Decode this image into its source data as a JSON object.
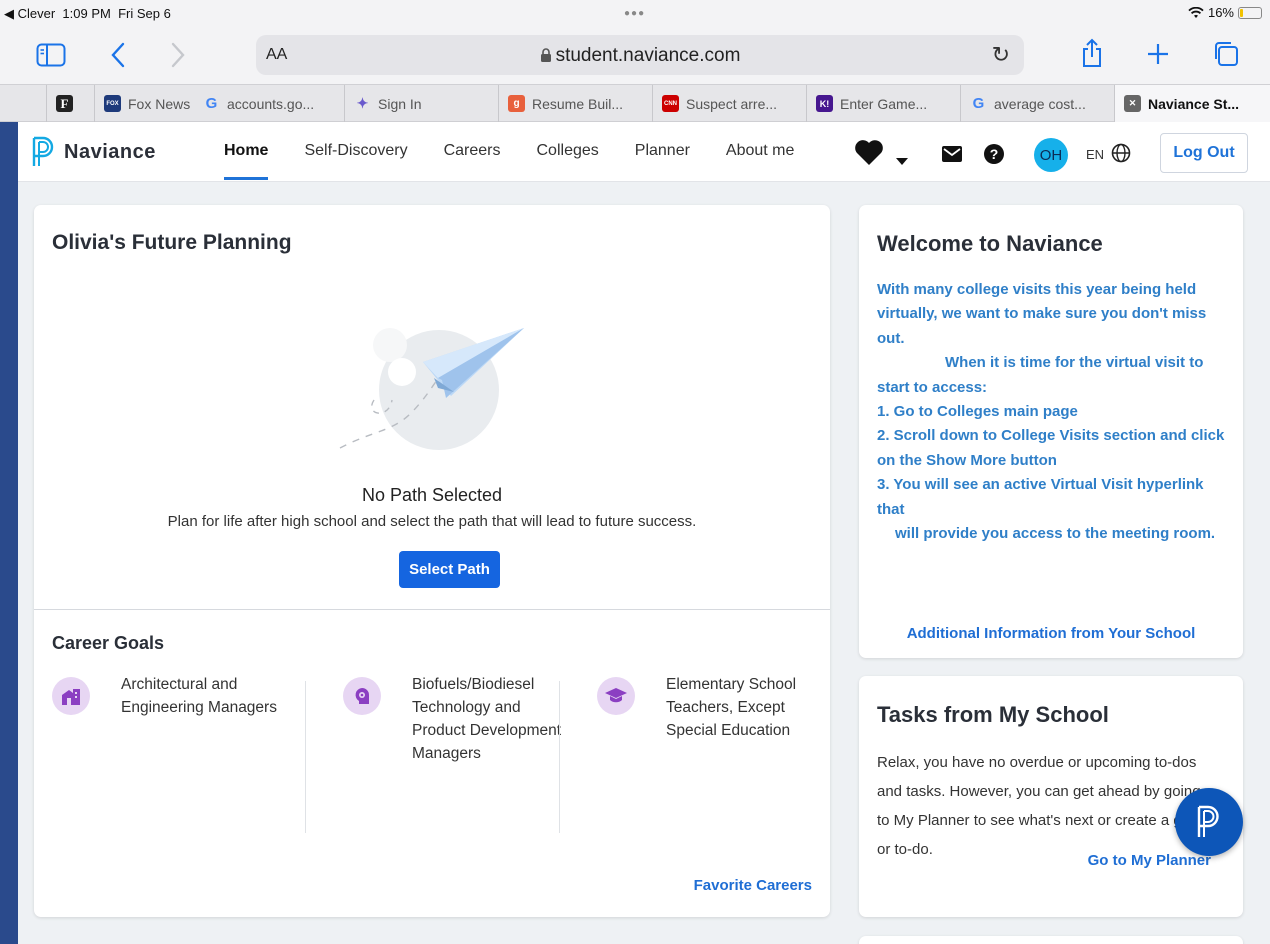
{
  "status_bar": {
    "back_app": "◀ Clever",
    "time": "1:09 PM",
    "date": "Fri Sep 6",
    "battery": "16%",
    "battery_level": 0.16
  },
  "browser": {
    "text_size_label": "AA",
    "url": "student.naviance.com"
  },
  "tabs": [
    {
      "label": "Fox News",
      "favicon_text": "FOX",
      "favicon_color": "#1e3a7b"
    },
    {
      "label": "accounts.go...",
      "favicon_text": "G",
      "favicon_color": "#4285f4"
    },
    {
      "label": "Sign In",
      "favicon_text": "✦",
      "favicon_color": "#6a5acd"
    },
    {
      "label": "Resume Buil...",
      "favicon_text": "g",
      "favicon_color": "#e8603c"
    },
    {
      "label": "Suspect arre...",
      "favicon_text": "CNN",
      "favicon_color": "#cc0000"
    },
    {
      "label": "Enter Game...",
      "favicon_text": "K!",
      "favicon_color": "#46178f"
    },
    {
      "label": "average cost...",
      "favicon_text": "G",
      "favicon_color": "#4285f4"
    },
    {
      "label": "Naviance St...",
      "favicon_text": "✕",
      "favicon_color": "#666666"
    }
  ],
  "nav": {
    "brand": "Naviance",
    "links": [
      "Home",
      "Self-Discovery",
      "Careers",
      "Colleges",
      "Planner",
      "About me"
    ],
    "avatar": "OH",
    "language": "EN",
    "logout": "Log Out"
  },
  "future_planning": {
    "title": "Olivia's Future Planning",
    "empty_title": "No Path Selected",
    "empty_desc": "Plan for life after high school and select the path that will lead to future success.",
    "select_button": "Select Path",
    "career_goals_title": "Career Goals",
    "goals": [
      {
        "label": "Architectural and Engineering Managers",
        "icon": "building-icon"
      },
      {
        "label": "Biofuels/Biodiesel Technology and Product Development Managers",
        "icon": "gear-head-icon"
      },
      {
        "label": "Elementary School Teachers, Except Special Education",
        "icon": "graduation-cap-icon"
      }
    ],
    "favorite_link": "Favorite Careers"
  },
  "welcome": {
    "title": "Welcome to Naviance",
    "body_lines": [
      "With many college visits this year being held virtually, we want to make sure you don't miss out.",
      "When it is time for the virtual visit to start to access:",
      "1. Go to Colleges main page",
      "2. Scroll down to College Visits section and click on the Show More button",
      "3. You will see an active Virtual Visit hyperlink that",
      "will provide you access to the meeting room."
    ],
    "link": "Additional Information from Your School"
  },
  "tasks": {
    "title": "Tasks from My School",
    "body": "Relax, you have no overdue or upcoming to-dos and tasks. However, you can get ahead by going to My Planner to see what's next or create a goal or to-do.",
    "link": "Go to My Planner"
  },
  "colors": {
    "accent": "#1565e0",
    "link": "#1f6ed4",
    "welcome_text": "#2f7fc8",
    "avatar": "#16b0ea",
    "goal_icon_bg": "#e7d6f3"
  }
}
